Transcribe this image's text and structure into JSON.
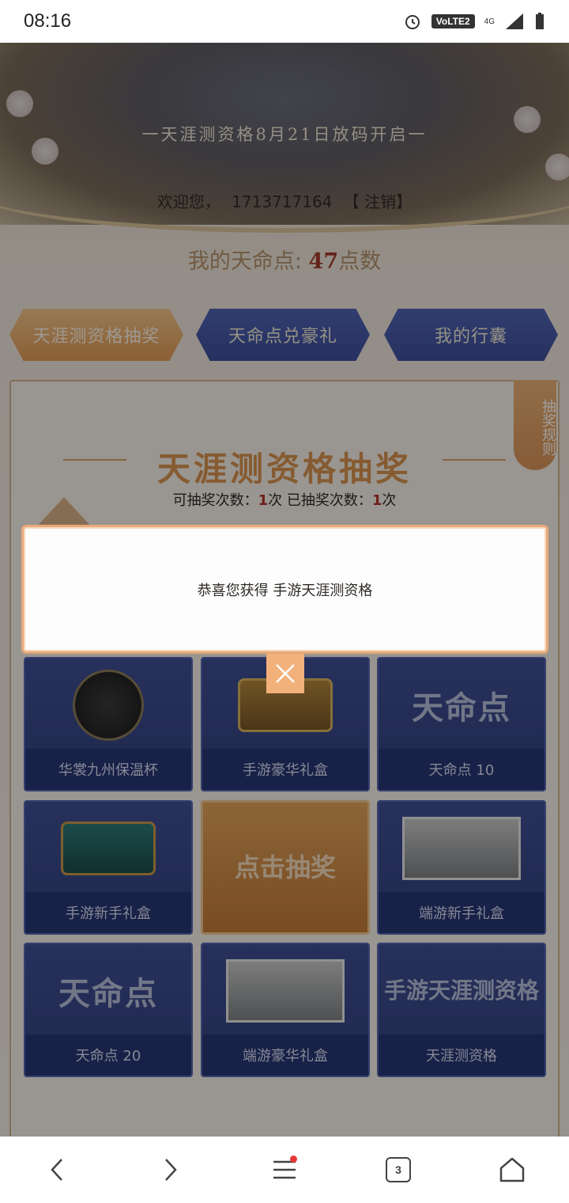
{
  "status_bar": {
    "time": "08:16",
    "volte": "VoLTE2",
    "network": "4G"
  },
  "banner": {
    "title": "一天涯测资格8月21日放码开启一"
  },
  "welcome": {
    "greeting": "欢迎您，",
    "user_id": "1713717164",
    "logout": "【 注销】"
  },
  "points": {
    "label": "我的天命点: ",
    "value": "47",
    "unit": "点数"
  },
  "tabs": [
    {
      "label": "天涯测资格抽奖",
      "active": true
    },
    {
      "label": "天命点兑豪礼",
      "active": false
    },
    {
      "label": "我的行囊",
      "active": false
    }
  ],
  "rules_tag": "抽奖规则",
  "section": {
    "title": "天涯测资格抽奖",
    "available_label": "可抽奖次数：",
    "available": "1",
    "available_unit": "次",
    "used_label": " 已抽奖次数：",
    "used": "1",
    "used_unit": "次"
  },
  "prizes": [
    {
      "label": "华裳九州保温杯",
      "art": "cup"
    },
    {
      "label": "手游豪华礼盒",
      "art": "chest"
    },
    {
      "label": "天命点 10",
      "art": "text",
      "art_text": "天命点"
    },
    {
      "label": "手游新手礼盒",
      "art": "chest-teal"
    },
    {
      "label": "端游新手礼盒",
      "art": "portrait"
    },
    {
      "label": "天命点 20",
      "art": "text",
      "art_text": "天命点"
    },
    {
      "label": "端游豪华礼盒",
      "art": "portrait"
    },
    {
      "label": "天涯测资格",
      "art": "text-small",
      "art_text": "手游天涯测资格"
    }
  ],
  "draw_button": "点击抽奖",
  "modal": {
    "message": "恭喜您获得 手游天涯测资格"
  },
  "colors": {
    "accent": "#e29b55",
    "tab_blue": "#3e4f9c",
    "highlight": "#a33b2d"
  },
  "bottom_nav": {
    "tab_count": "3"
  }
}
